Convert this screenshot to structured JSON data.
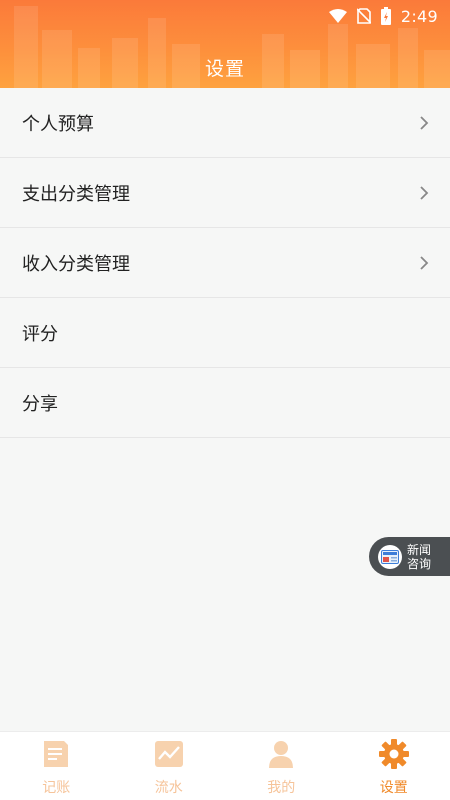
{
  "status_bar": {
    "time": "2:49"
  },
  "header": {
    "title": "设置"
  },
  "menu": {
    "items": [
      {
        "label": "个人预算",
        "chevron": true
      },
      {
        "label": "支出分类管理",
        "chevron": true
      },
      {
        "label": "收入分类管理",
        "chevron": true
      },
      {
        "label": "评分",
        "chevron": false
      },
      {
        "label": "分享",
        "chevron": false
      }
    ]
  },
  "news_float": {
    "line1": "新闻",
    "line2": "咨询"
  },
  "bottom_nav": {
    "items": [
      {
        "label": "记账",
        "icon": "notebook-icon",
        "active": false
      },
      {
        "label": "流水",
        "icon": "chart-icon",
        "active": false
      },
      {
        "label": "我的",
        "icon": "person-icon",
        "active": false
      },
      {
        "label": "设置",
        "icon": "gear-icon",
        "active": true
      }
    ]
  },
  "colors": {
    "header_orange": "#fb7a3a",
    "active_accent": "#f08a2a",
    "inactive_tab": "#f6c49a"
  }
}
